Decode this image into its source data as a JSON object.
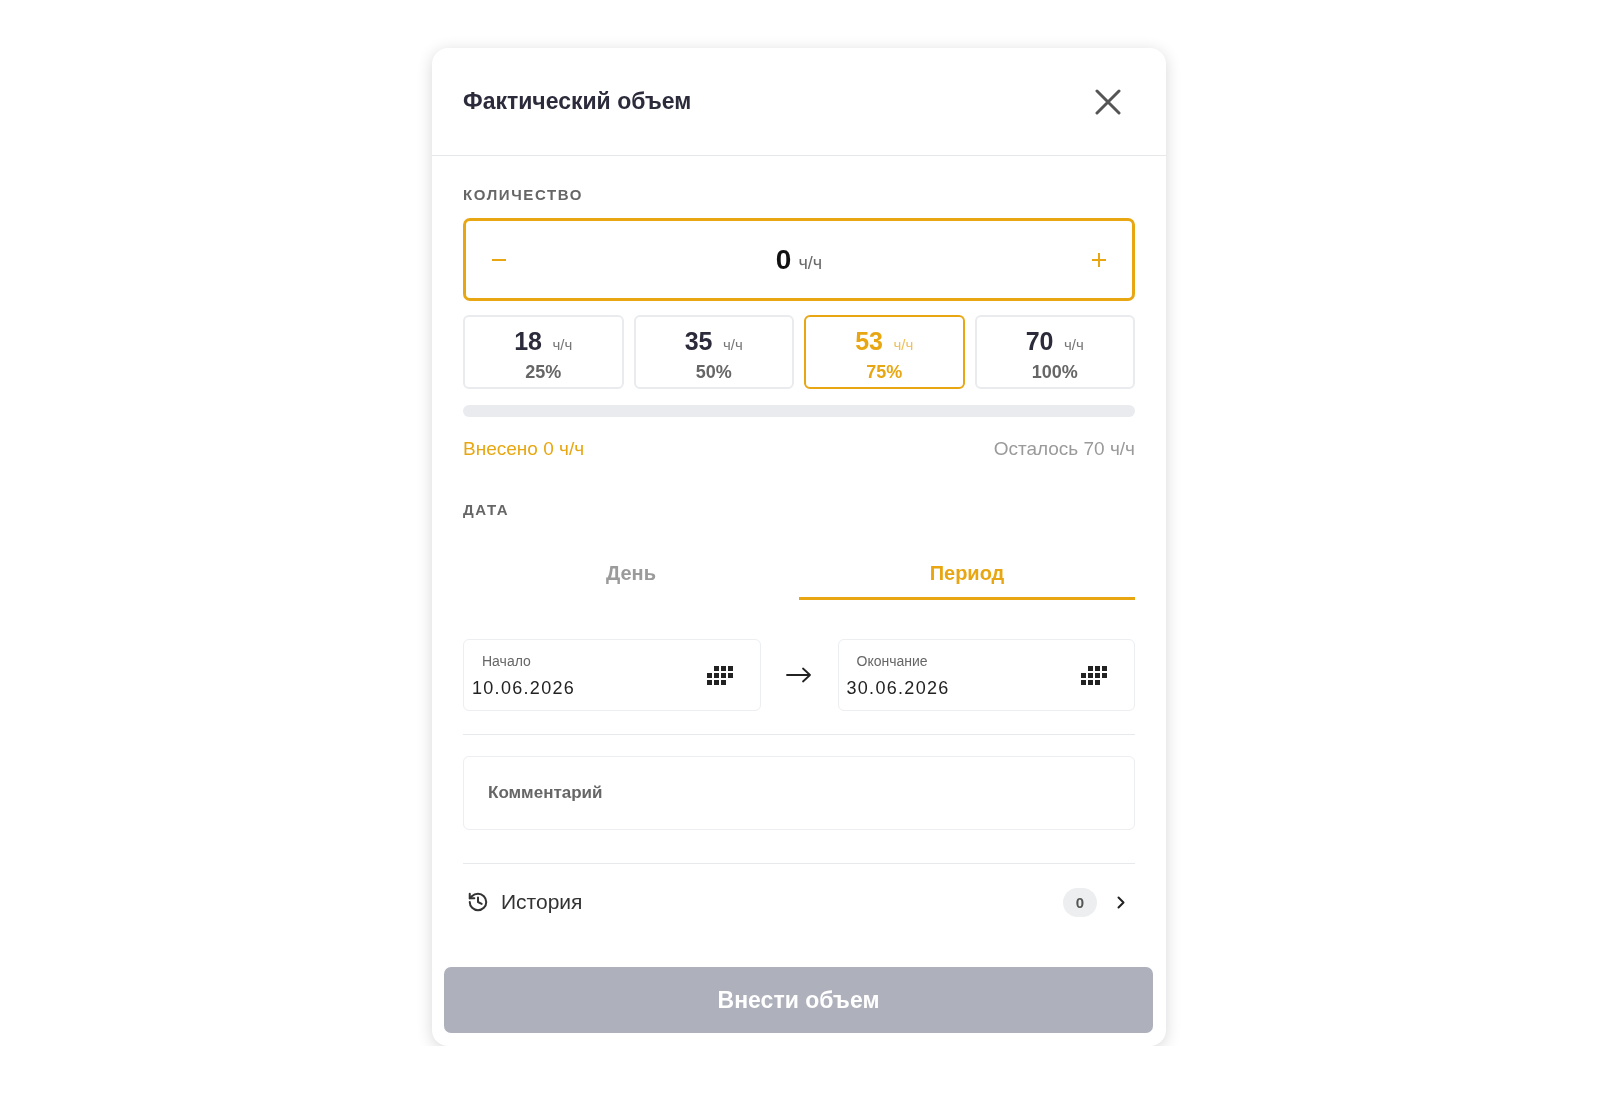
{
  "dialog": {
    "title": "Фактический объем"
  },
  "quantity": {
    "label": "КОЛИЧЕСТВО",
    "value": "0",
    "unit": "ч/ч"
  },
  "presets": [
    {
      "value": "18",
      "unit": "ч/ч",
      "percent": "25%",
      "selected": false
    },
    {
      "value": "35",
      "unit": "ч/ч",
      "percent": "50%",
      "selected": false
    },
    {
      "value": "53",
      "unit": "ч/ч",
      "percent": "75%",
      "selected": true
    },
    {
      "value": "70",
      "unit": "ч/ч",
      "percent": "100%",
      "selected": false
    }
  ],
  "progress": {
    "level": 0,
    "entered": "Внесено 0 ч/ч",
    "remaining": "Осталось 70 ч/ч"
  },
  "date": {
    "label": "ДАТА",
    "tabs": [
      {
        "label": "День",
        "selected": false
      },
      {
        "label": "Период",
        "selected": true
      }
    ],
    "start": {
      "label": "Начало",
      "value": "10.06.2026"
    },
    "end": {
      "label": "Окончание",
      "value": "30.06.2026"
    }
  },
  "comment": {
    "placeholder": "Комментарий"
  },
  "history": {
    "label": "История",
    "count": "0"
  },
  "submit": {
    "label": "Внести объем",
    "disabled": true
  }
}
